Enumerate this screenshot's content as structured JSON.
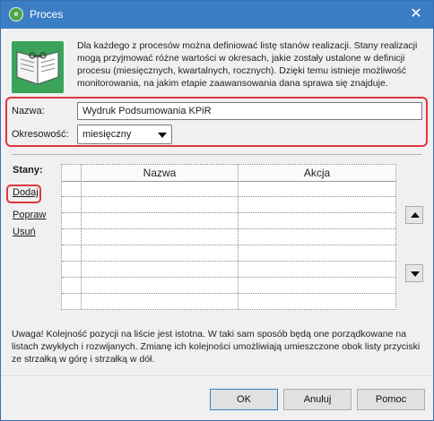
{
  "window": {
    "title": "Proces",
    "icon": "app-icon",
    "close_glyph": "✕"
  },
  "description": "Dla każdego z procesów można definiować listę stanów realizacji. Stany realizacji mogą przyjmować różne wartości w okresach, jakie zostały ustalone w definicji procesu (miesięcznych, kwartalnych, rocznych). Dzięki temu istnieje możliwość monitorowania, na jakim etapie zaawansowania dana sprawa się znajduje.",
  "form": {
    "nazwa_label": "Nazwa:",
    "nazwa_value": "Wydruk Podsumowania KPiR",
    "okresowosc_label": "Okresowość:",
    "okresowosc_value": "miesięczny"
  },
  "stany": {
    "label": "Stany:",
    "links": {
      "dodaj": "Dodaj",
      "popraw": "Popraw",
      "usun": "Usuń"
    },
    "columns": [
      "Nazwa",
      "Akcja"
    ],
    "rows": []
  },
  "note": "Uwaga! Kolejność pozycji na liście jest istotna. W taki sam sposób będą one porządkowane na listach zwykłych i rozwijanych. Zmianę ich kolejności umożliwiają umieszczone obok listy przyciski ze strzałką w górę i strzałką w dół.",
  "buttons": {
    "ok": "OK",
    "anuluj": "Anuluj",
    "pomoc": "Pomoc"
  },
  "colors": {
    "titlebar": "#3c7ec6",
    "highlight": "#e0373f",
    "icon_green": "#3aa35a"
  }
}
